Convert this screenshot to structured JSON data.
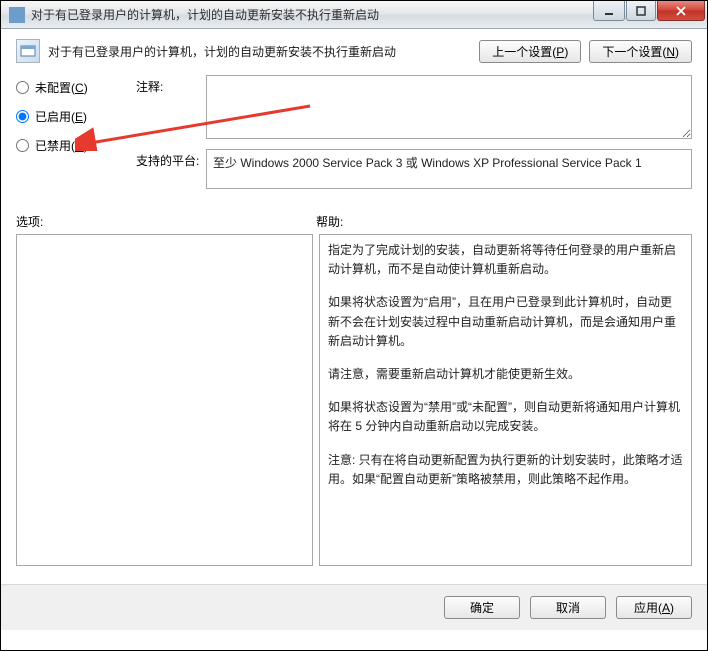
{
  "window": {
    "title": "对于有已登录用户的计算机，计划的自动更新安装不执行重新启动"
  },
  "header": {
    "title": "对于有已登录用户的计算机，计划的自动更新安装不执行重新启动",
    "prev_label": "上一个设置",
    "prev_accel": "P",
    "next_label": "下一个设置",
    "next_accel": "N"
  },
  "radios": {
    "not_configured": {
      "label": "未配置",
      "accel": "C",
      "checked": false
    },
    "enabled": {
      "label": "已启用",
      "accel": "E",
      "checked": true
    },
    "disabled": {
      "label": "已禁用",
      "accel": "D",
      "checked": false
    }
  },
  "fields": {
    "comment_label": "注释:",
    "comment_value": "",
    "platform_label": "支持的平台:",
    "platform_value": "至少 Windows 2000 Service Pack 3 或 Windows XP Professional Service Pack 1"
  },
  "sections": {
    "options_label": "选项:",
    "help_label": "帮助:"
  },
  "help": {
    "p1": "指定为了完成计划的安装，自动更新将等待任何登录的用户重新启动计算机，而不是自动使计算机重新启动。",
    "p2": "如果将状态设置为“启用”，且在用户已登录到此计算机时，自动更新不会在计划安装过程中自动重新启动计算机，而是会通知用户重新启动计算机。",
    "p3": "请注意，需要重新启动计算机才能使更新生效。",
    "p4": "如果将状态设置为“禁用”或“未配置”，则自动更新将通知用户计算机将在 5 分钟内自动重新启动以完成安装。",
    "p5": "注意: 只有在将自动更新配置为执行更新的计划安装时，此策略才适用。如果“配置自动更新”策略被禁用，则此策略不起作用。"
  },
  "footer": {
    "ok_label": "确定",
    "cancel_label": "取消",
    "apply_label": "应用",
    "apply_accel": "A"
  },
  "annotation": {
    "arrow_color": "#e63a2e"
  }
}
